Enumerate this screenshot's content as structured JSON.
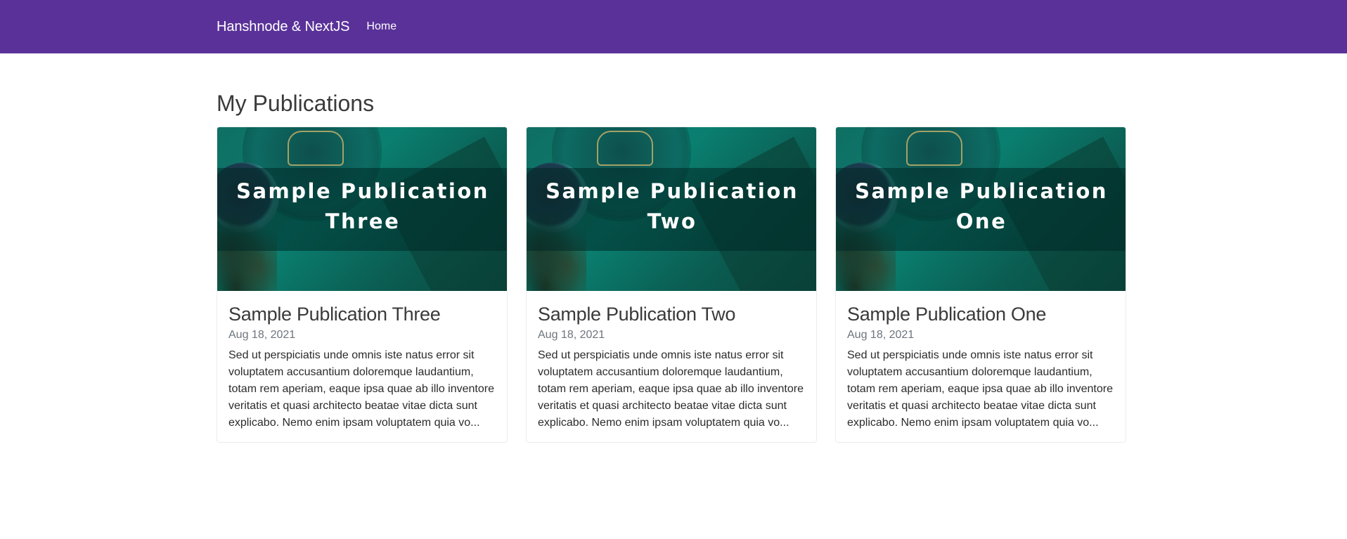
{
  "navbar": {
    "brand": "Hanshnode & NextJS",
    "links": [
      "Home"
    ],
    "background": "#5a3199"
  },
  "main": {
    "title": "My Publications",
    "publications": [
      {
        "cover_title": "Sample Publication Three",
        "title": "Sample Publication Three",
        "date": "Aug 18, 2021",
        "excerpt": "Sed ut perspiciatis unde omnis iste natus error sit voluptatem accusantium doloremque laudantium, totam rem aperiam, eaque ipsa quae ab illo inventore veritatis et quasi architecto beatae vitae dicta sunt explicabo. Nemo enim ipsam voluptatem quia vo..."
      },
      {
        "cover_title": "Sample Publication Two",
        "title": "Sample Publication Two",
        "date": "Aug 18, 2021",
        "excerpt": "Sed ut perspiciatis unde omnis iste natus error sit voluptatem accusantium doloremque laudantium, totam rem aperiam, eaque ipsa quae ab illo inventore veritatis et quasi architecto beatae vitae dicta sunt explicabo. Nemo enim ipsam voluptatem quia vo..."
      },
      {
        "cover_title": "Sample Publication One",
        "title": "Sample Publication One",
        "date": "Aug 18, 2021",
        "excerpt": "Sed ut perspiciatis unde omnis iste natus error sit voluptatem accusantium doloremque laudantium, totam rem aperiam, eaque ipsa quae ab illo inventore veritatis et quasi architecto beatae vitae dicta sunt explicabo. Nemo enim ipsam voluptatem quia vo..."
      }
    ]
  }
}
